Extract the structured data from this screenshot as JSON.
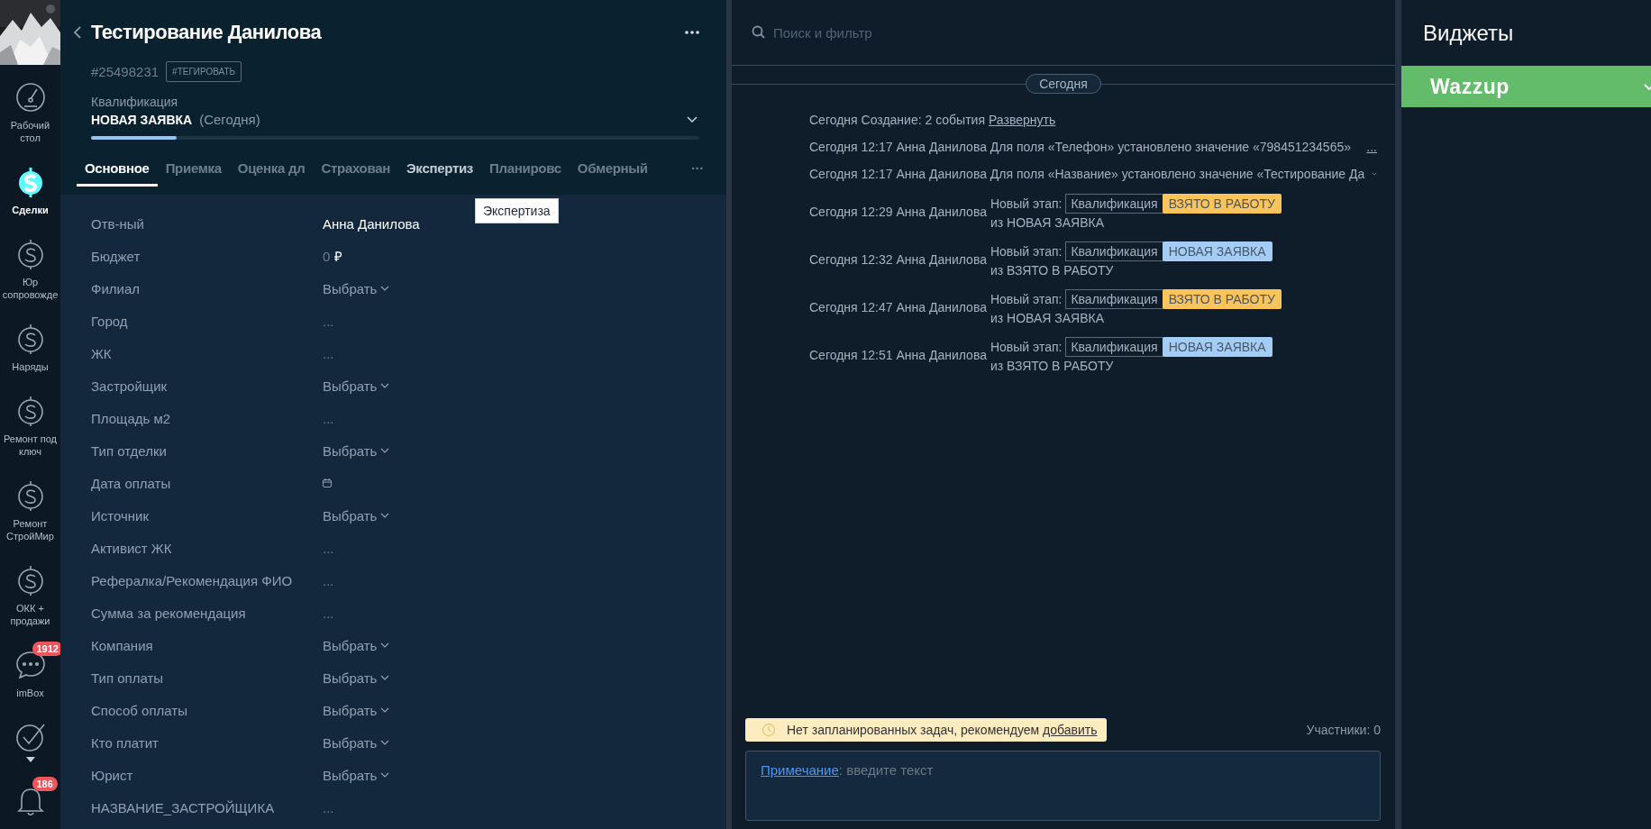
{
  "nav": [
    {
      "kind": "gauge",
      "label": "Рабочий стол",
      "selected": false
    },
    {
      "kind": "dollar",
      "label": "Сделки",
      "selected": true
    },
    {
      "kind": "dollar",
      "label": "Юр сопровожде",
      "selected": false
    },
    {
      "kind": "dollar",
      "label": "Наряды",
      "selected": false
    },
    {
      "kind": "dollar",
      "label": "Ремонт под ключ",
      "selected": false
    },
    {
      "kind": "dollar",
      "label": "Ремонт СтройМир",
      "selected": false
    },
    {
      "kind": "dollar",
      "label": "ОКК + продажи",
      "selected": false
    },
    {
      "kind": "chat",
      "label": "imBox",
      "badge": "1912",
      "selected": false
    },
    {
      "kind": "check",
      "selected": false
    },
    {
      "kind": "bell",
      "badge": "186",
      "selected": false
    }
  ],
  "lead": {
    "title": "Тестирование Данилова",
    "id": "#25498231",
    "tag_button": "#ТЕГИРОВАТЬ",
    "pipeline": "Квалификация",
    "stage": "НОВАЯ ЗАЯВКА",
    "stage_date": "(Сегодня)",
    "stage_progress": {
      "level": 0.14
    }
  },
  "tabs": [
    {
      "label": "Основное",
      "selected": true,
      "hovered": false
    },
    {
      "label": "Приемка",
      "selected": false,
      "hovered": false
    },
    {
      "label": "Оценка дл",
      "selected": false,
      "hovered": false
    },
    {
      "label": "Страхован",
      "selected": false,
      "hovered": false
    },
    {
      "label": "Экспертиз",
      "selected": false,
      "hovered": true
    },
    {
      "label": "Планировс",
      "selected": false,
      "hovered": false
    },
    {
      "label": "Обмерный",
      "selected": false,
      "hovered": false
    }
  ],
  "more_tabs": "···",
  "tooltip": "Экспертиза",
  "fields": [
    {
      "label": "Отв-ный",
      "kind": "text",
      "value": "Анна Данилова"
    },
    {
      "label": "Бюджет",
      "kind": "money",
      "value": "0",
      "currency": "₽"
    },
    {
      "label": "Филиал",
      "kind": "select",
      "value": "Выбрать"
    },
    {
      "label": "Город",
      "kind": "empty",
      "value": "..."
    },
    {
      "label": "ЖК",
      "kind": "empty",
      "value": "..."
    },
    {
      "label": "Застройщик",
      "kind": "select",
      "value": "Выбрать"
    },
    {
      "label": "Площадь м2",
      "kind": "empty",
      "value": "..."
    },
    {
      "label": "Тип отделки",
      "kind": "select",
      "value": "Выбрать"
    },
    {
      "label": "Дата оплаты",
      "kind": "date"
    },
    {
      "label": "Источник",
      "kind": "select",
      "value": "Выбрать"
    },
    {
      "label": "Активист ЖК",
      "kind": "empty",
      "value": "..."
    },
    {
      "label": "Рефералка/Рекомендация ФИО",
      "kind": "empty",
      "value": "..."
    },
    {
      "label": "Сумма за рекомендация",
      "kind": "empty",
      "value": "..."
    },
    {
      "label": "Компания",
      "kind": "select",
      "value": "Выбрать"
    },
    {
      "label": "Тип оплаты",
      "kind": "select",
      "value": "Выбрать"
    },
    {
      "label": "Способ оплаты",
      "kind": "select",
      "value": "Выбрать"
    },
    {
      "label": "Кто платит",
      "kind": "select",
      "value": "Выбрать"
    },
    {
      "label": "Юрист",
      "kind": "select",
      "value": "Выбрать"
    },
    {
      "label": "НАЗВАНИЕ_ЗАСТРОЙЩИКА",
      "kind": "empty",
      "value": "..."
    }
  ],
  "feed": {
    "search": {
      "placeholder": "Поиск и фильтр"
    },
    "day": "Сегодня",
    "entries": [
      {
        "kind": "summary",
        "text": "Сегодня Создание: 2 события",
        "link": "Развернуть"
      },
      {
        "kind": "change",
        "text": "Сегодня 12:17 Анна Данилова Для поля «Телефон» установлено значение «798451234565»",
        "more": "...",
        "expandable": false
      },
      {
        "kind": "change",
        "text": "Сегодня 12:17 Анна Данилова Для поля «Название» установлено значение «Тестирование Да",
        "expandable": true
      },
      {
        "kind": "stage",
        "author": "Сегодня 12:29 Анна Данилова",
        "label": "Новый этап:",
        "pipeline": "Квалификация",
        "status": {
          "text": "ВЗЯТО В РАБОТУ",
          "color": "#fbc45a"
        },
        "from": "из НОВАЯ ЗАЯВКА"
      },
      {
        "kind": "stage",
        "author": "Сегодня 12:32 Анна Данилова",
        "label": "Новый этап:",
        "pipeline": "Квалификация",
        "status": {
          "text": "НОВАЯ ЗАЯВКА",
          "color": "#a3cdf7"
        },
        "from": "из ВЗЯТО В РАБОТУ"
      },
      {
        "kind": "stage",
        "author": "Сегодня 12:47 Анна Данилова",
        "label": "Новый этап:",
        "pipeline": "Квалификация",
        "status": {
          "text": "ВЗЯТО В РАБОТУ",
          "color": "#fbc45a"
        },
        "from": "из НОВАЯ ЗАЯВКА"
      },
      {
        "kind": "stage",
        "author": "Сегодня 12:51 Анна Данилова",
        "label": "Новый этап:",
        "pipeline": "Квалификация",
        "status": {
          "text": "НОВАЯ ЗАЯВКА",
          "color": "#a3cdf7"
        },
        "from": "из ВЗЯТО В РАБОТУ"
      }
    ],
    "task_notice": {
      "text": "Нет запланированных задач, рекомендуем ",
      "link": "добавить"
    },
    "participants": "Участники: 0",
    "note": {
      "link": "Примечание",
      "placeholder": ": введите текст"
    }
  },
  "widgets": {
    "title": "Виджеты",
    "items": [
      {
        "name": "Wazzup",
        "expanded": false
      }
    ]
  }
}
